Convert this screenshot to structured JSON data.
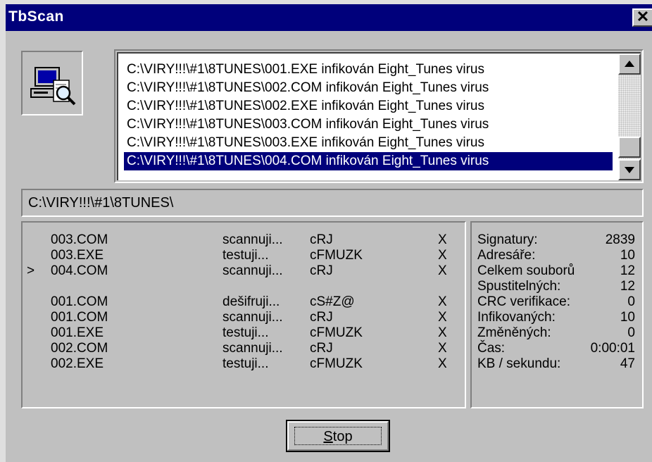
{
  "window": {
    "title": "TbScan",
    "close_glyph": "✕"
  },
  "icon": {
    "name": "computer-scan-icon"
  },
  "results": {
    "items": [
      "C:\\VIRY!!!\\#1\\8TUNES\\001.EXE infikován  Eight_Tunes virus",
      "C:\\VIRY!!!\\#1\\8TUNES\\002.COM infikován  Eight_Tunes virus",
      "C:\\VIRY!!!\\#1\\8TUNES\\002.EXE infikován  Eight_Tunes virus",
      "C:\\VIRY!!!\\#1\\8TUNES\\003.COM infikován  Eight_Tunes virus",
      "C:\\VIRY!!!\\#1\\8TUNES\\003.EXE infikován  Eight_Tunes virus",
      "C:\\VIRY!!!\\#1\\8TUNES\\004.COM infikován  Eight_Tunes virus"
    ],
    "selected_index": 5,
    "scroll_up_glyph": "▲",
    "scroll_down_glyph": "▼"
  },
  "current_path": "C:\\VIRY!!!\\#1\\8TUNES\\",
  "scan_rows": [
    {
      "mark": "",
      "file": "003.COM",
      "action": "scannuji...",
      "code": "cRJ",
      "x": "X"
    },
    {
      "mark": "",
      "file": "003.EXE",
      "action": "testuji...",
      "code": "cFMUZK",
      "x": "X"
    },
    {
      "mark": ">",
      "file": "004.COM",
      "action": "scannuji...",
      "code": "cRJ",
      "x": "X"
    },
    {
      "mark": "",
      "file": "",
      "action": "",
      "code": "",
      "x": ""
    },
    {
      "mark": "",
      "file": "001.COM",
      "action": "dešifruji...",
      "code": "cS#Z@",
      "x": "X"
    },
    {
      "mark": "",
      "file": "001.COM",
      "action": "scannuji...",
      "code": "cRJ",
      "x": "X"
    },
    {
      "mark": "",
      "file": "001.EXE",
      "action": "testuji...",
      "code": "cFMUZK",
      "x": "X"
    },
    {
      "mark": "",
      "file": "002.COM",
      "action": "scannuji...",
      "code": "cRJ",
      "x": "X"
    },
    {
      "mark": "",
      "file": "002.EXE",
      "action": "testuji...",
      "code": "cFMUZK",
      "x": "X"
    }
  ],
  "stats": [
    {
      "label": "Signatury:",
      "value": "2839"
    },
    {
      "label": "Adresáře:",
      "value": "10"
    },
    {
      "label": "Celkem souborů",
      "value": "12"
    },
    {
      "label": "Spustitelných:",
      "value": "12"
    },
    {
      "label": "CRC verifikace:",
      "value": "0"
    },
    {
      "label": "Infikovaných:",
      "value": "10"
    },
    {
      "label": "Změněných:",
      "value": "0"
    },
    {
      "label": "Čas:",
      "value": "0:00:01"
    },
    {
      "label": "KB / sekundu:",
      "value": "47"
    }
  ],
  "buttons": {
    "stop_prefix": "",
    "stop_underlined": "S",
    "stop_rest": "top"
  }
}
